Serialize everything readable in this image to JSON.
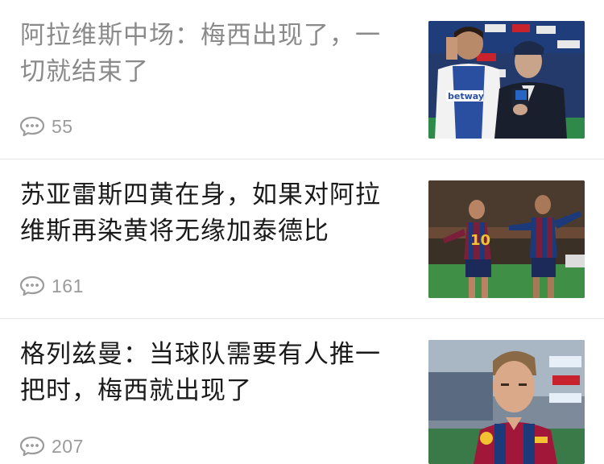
{
  "feed": {
    "items": [
      {
        "headline_line1": "阿拉维斯中场：梅西出现了，一",
        "headline_line2": "切就结束了",
        "comments": "55",
        "read": true,
        "thumb_icon": "post-match-interview-photo"
      },
      {
        "headline_line1": "苏亚雷斯四黄在身，如果对阿拉",
        "headline_line2": "维斯再染黄将无缘加泰德比",
        "comments": "161",
        "read": false,
        "thumb_icon": "goal-celebration-photo"
      },
      {
        "headline_line1": "格列兹曼：当球队需要有人推一",
        "headline_line2": "把时，梅西就出现了",
        "comments": "207",
        "read": false,
        "thumb_icon": "player-portrait-photo"
      }
    ],
    "colors": {
      "headline": "#1a1a1a",
      "headline_read": "#8a8a8a",
      "meta": "#9b9b9b",
      "divider": "#e6e6e6"
    }
  }
}
